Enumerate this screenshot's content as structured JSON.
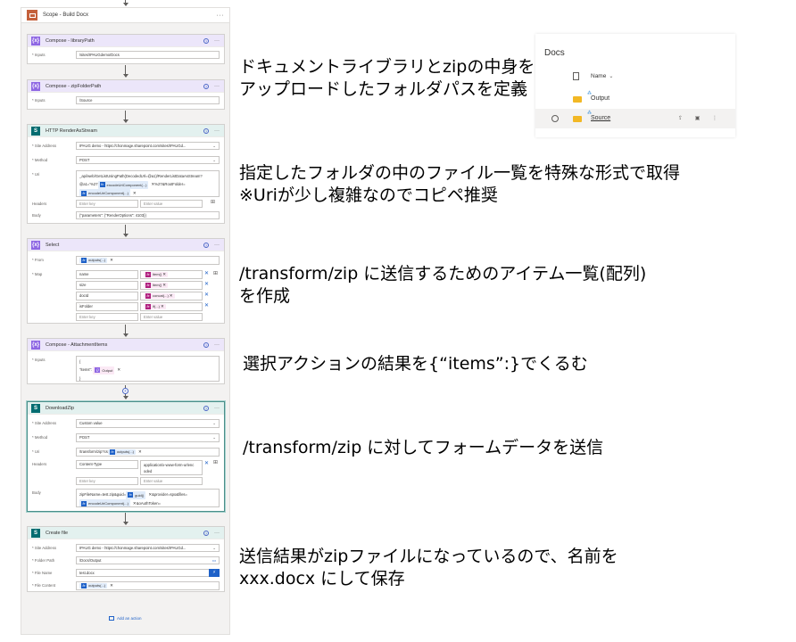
{
  "scope": {
    "title": "Scope - Build Docx",
    "more": "···"
  },
  "cards": {
    "library": {
      "title": "Compose - libraryPath",
      "inputs_label": "* Inputs",
      "inputs_value": "/sites/IPAUGdemo/Docs"
    },
    "zip": {
      "title": "Compose - zipFolderPath",
      "inputs_label": "* Inputs",
      "inputs_value": "/Source"
    },
    "http": {
      "title": "HTTP RenderAsStream",
      "site_label": "* Site Address",
      "site_value": "IPAUG demo - https://chonmage.sharepoint.com/sites/IPAUGd...",
      "method_label": "* Method",
      "method_value": "POST",
      "uri_label": "* Uri",
      "uri_line1": "_api/web/GetListUsingPath(DecodedUrl=@a1)/RenderListDataAsStream?",
      "uri_line2_pre": "@a1='%27",
      "uri_token1": "encodeUriComponent(...)",
      "uri_line2_post": "%27&RootFolder=",
      "uri_token2": "encodeUriComponent(...)",
      "headers_label": "Headers",
      "enter_key": "Enter key",
      "enter_value": "Enter value",
      "body_label": "Body",
      "body_value": "{\"parameters\": {\"RenderOptions\": 4103}}"
    },
    "select": {
      "title": "Select",
      "from_label": "* From",
      "from_token": "outputs(...)",
      "map_label": "* Map",
      "map_rows": [
        {
          "key": "name",
          "token": "item()"
        },
        {
          "key": "size",
          "token": "item()"
        },
        {
          "key": "docId",
          "token": "concat(...)"
        },
        {
          "key": "isFolder",
          "token": "if(...)"
        }
      ],
      "enter_key": "Enter key",
      "enter_value": "Enter value"
    },
    "attach": {
      "title": "Compose - AttachmentItems",
      "inputs_label": "* Inputs",
      "line1": "{",
      "line2_pre": "\"items\":",
      "line2_token": "Output",
      "line3": "}"
    },
    "download": {
      "title": "DownloadZip",
      "site_label": "* Site Address",
      "site_value": "Custom value",
      "method_label": "* Method",
      "method_value": "POST",
      "uri_label": "* Uri",
      "uri_pre": "/transform/zip?cs",
      "uri_token": "outputs(...)",
      "headers_label": "Headers",
      "header_key": "Content-Type",
      "header_value_1": "application/x-www-form-urlenc",
      "header_value_2": "oded",
      "enter_key": "Enter key",
      "enter_value": "Enter value",
      "body_label": "Body",
      "body_pre": "zipFileName=test.zip&guid=",
      "body_token1": "guid()",
      "body_mid": "&provider=spo&files=",
      "body_token2": "encodeUriComponent(...)",
      "body_post": "&oAuthToken="
    },
    "create": {
      "title": "Create file",
      "site_label": "* Site Address",
      "site_value": "IPAUG demo - https://chonmage.sharepoint.com/sites/IPAUGd...",
      "folder_label": "* Folder Path",
      "folder_value": "/Docs/Output",
      "filename_label": "* File Name",
      "filename_value": "test.docx",
      "content_label": "* File Content",
      "content_token": "outputs(...)"
    }
  },
  "add_action": "Add an action",
  "notes": [
    [
      "ドキュメントライブラリとzipの中身を",
      "アップロードしたフォルダパスを定義"
    ],
    [
      "指定したフォルダの中のファイル一覧を特殊な形式で取得",
      "※Uriが少し複雑なのでコピペ推奨"
    ],
    [
      "/transform/zip に送信するためのアイテム一覧(配列)",
      "を作成"
    ],
    [
      "選択アクションの結果を{“items”:}でくるむ"
    ],
    [
      "/transform/zip に対してフォームデータを送信"
    ],
    [
      "送信結果がzipファイルになっているので、名前を",
      "xxx.docx にして保存"
    ]
  ],
  "docs": {
    "title": "Docs",
    "col_name": "Name",
    "items": [
      "Output",
      "Source"
    ]
  },
  "colors": {
    "scope_accent": "#c4603b",
    "compose_accent": "#8e67e3",
    "sharepoint_accent": "#036c70",
    "token_blue": "#1e61c8",
    "token_magenta": "#b0207f"
  }
}
